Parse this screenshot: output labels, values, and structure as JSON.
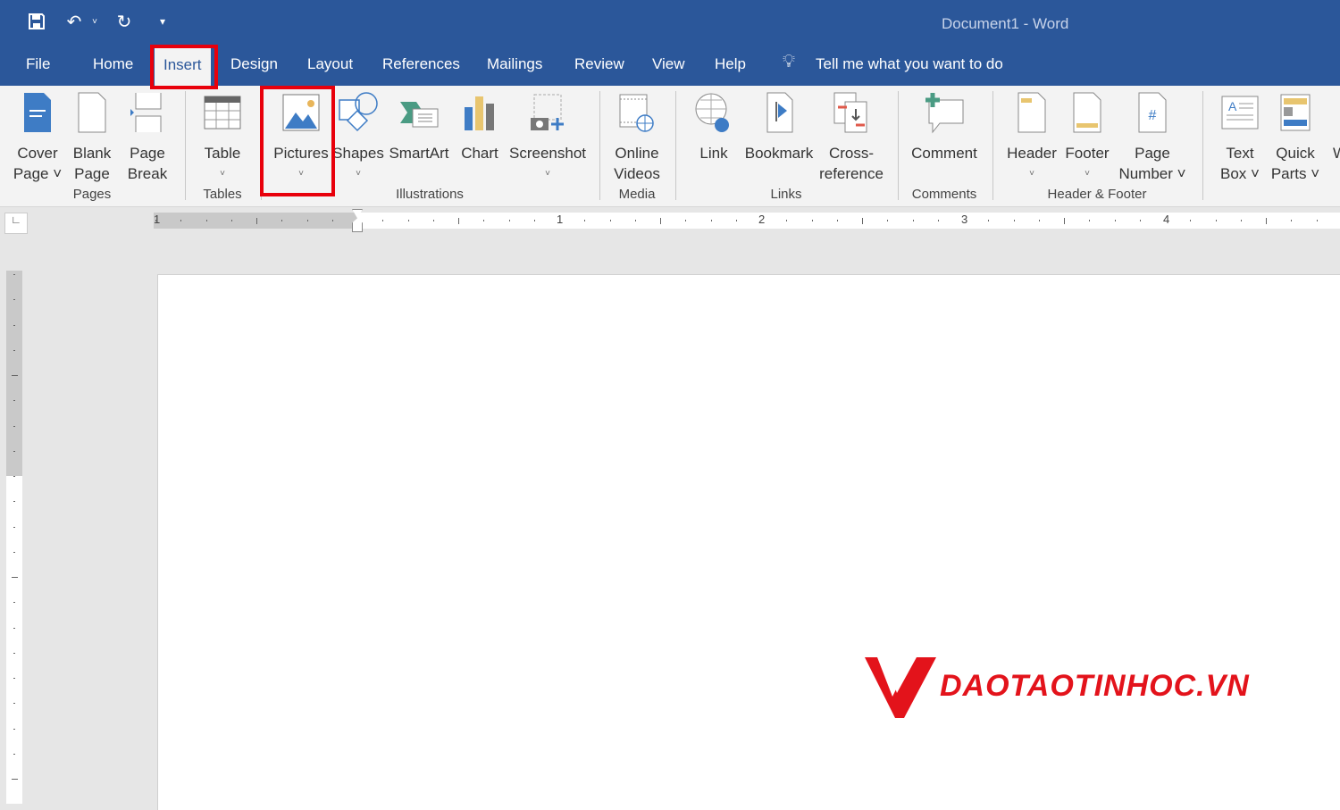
{
  "window": {
    "title": "Document1  -  Word"
  },
  "qat": {
    "save": "save-icon",
    "undo": "undo-icon",
    "redo": "redo-icon",
    "customize": "customize-icon"
  },
  "tabs": [
    "File",
    "Home",
    "Insert",
    "Design",
    "Layout",
    "References",
    "Mailings",
    "Review",
    "View",
    "Help"
  ],
  "active_tab": "Insert",
  "tell_me": "Tell me what you want to do",
  "ribbon": {
    "buttons": [
      {
        "l1": "Cover",
        "l2": "Page ˅"
      },
      {
        "l1": "Blank",
        "l2": "Page"
      },
      {
        "l1": "Page",
        "l2": "Break"
      },
      {
        "l1": "Table",
        "l2": "˅"
      },
      {
        "l1": "Pictures",
        "l2": "˅"
      },
      {
        "l1": "Shapes",
        "l2": "˅"
      },
      {
        "l1": "SmartArt",
        "l2": ""
      },
      {
        "l1": "Chart",
        "l2": ""
      },
      {
        "l1": "Screenshot",
        "l2": "˅"
      },
      {
        "l1": "Online",
        "l2": "Videos"
      },
      {
        "l1": "Link",
        "l2": ""
      },
      {
        "l1": "Bookmark",
        "l2": ""
      },
      {
        "l1": "Cross-",
        "l2": "reference"
      },
      {
        "l1": "Comment",
        "l2": ""
      },
      {
        "l1": "Header",
        "l2": "˅"
      },
      {
        "l1": "Footer",
        "l2": "˅"
      },
      {
        "l1": "Page",
        "l2": "Number ˅"
      },
      {
        "l1": "Text",
        "l2": "Box ˅"
      },
      {
        "l1": "Quick",
        "l2": "Parts ˅"
      },
      {
        "l1": "W",
        "l2": ""
      }
    ],
    "groups": [
      "Pages",
      "Tables",
      "Illustrations",
      "Media",
      "Links",
      "Comments",
      "Header & Footer"
    ]
  },
  "ruler": {
    "numbers": [
      "1",
      "1",
      "2",
      "3",
      "4"
    ]
  },
  "watermark": "DAOTAOTINHOC.VN",
  "colors": {
    "brand": "#2b579a",
    "highlight": "#e8000b",
    "logo": "#e3131b"
  }
}
